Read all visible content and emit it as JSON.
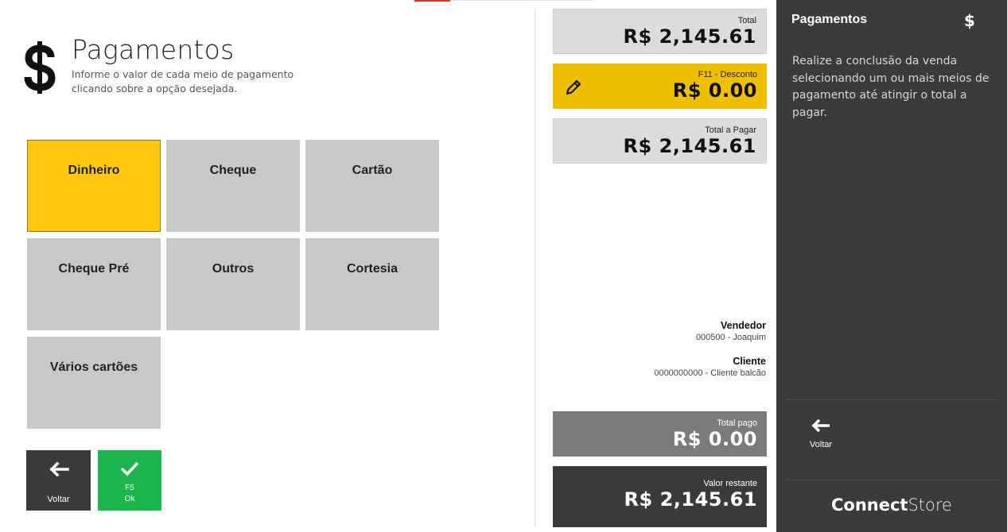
{
  "header": {
    "title": "Pagamentos",
    "subtitle": "Informe o valor de cada meio de pagamento clicando sobre a opção desejada."
  },
  "payment_methods": [
    {
      "label": "Dinheiro",
      "selected": true
    },
    {
      "label": "Cheque",
      "selected": false
    },
    {
      "label": "Cartão",
      "selected": false
    },
    {
      "label": "Cheque Pré",
      "selected": false
    },
    {
      "label": "Outros",
      "selected": false
    },
    {
      "label": "Cortesia",
      "selected": false
    },
    {
      "label": "Vários cartões",
      "selected": false
    }
  ],
  "buttons": {
    "back_label": "Voltar",
    "ok_key": "F5",
    "ok_label": "Ok"
  },
  "totals": {
    "total_label": "Total",
    "total_value": "R$ 2,145.61",
    "discount_label": "F11 - Desconto",
    "discount_value": "R$ 0.00",
    "topay_label": "Total a Pagar",
    "topay_value": "R$ 2,145.61",
    "paid_label": "Total pago",
    "paid_value": "R$ 0.00",
    "remaining_label": "Valor restante",
    "remaining_value": "R$ 2,145.61"
  },
  "info": {
    "seller_label": "Vendedor",
    "seller_value": "000500 - Joaquim",
    "client_label": "Cliente",
    "client_value": "0000000000 - Cliente balcão"
  },
  "side_panel": {
    "title": "Pagamentos",
    "icon": "$",
    "description": "Realize a conclusão da venda selecionando um ou mais meios de pagamento até atingir o total a pagar.",
    "back_label": "Voltar",
    "brand_part1": "Connect",
    "brand_part2": "Store"
  },
  "colors": {
    "selected_tile": "#fec90f",
    "tile": "#c8c8c8",
    "ok_button": "#1db54e",
    "discount_box": "#f0c000",
    "panel": "#3b3b3b"
  }
}
